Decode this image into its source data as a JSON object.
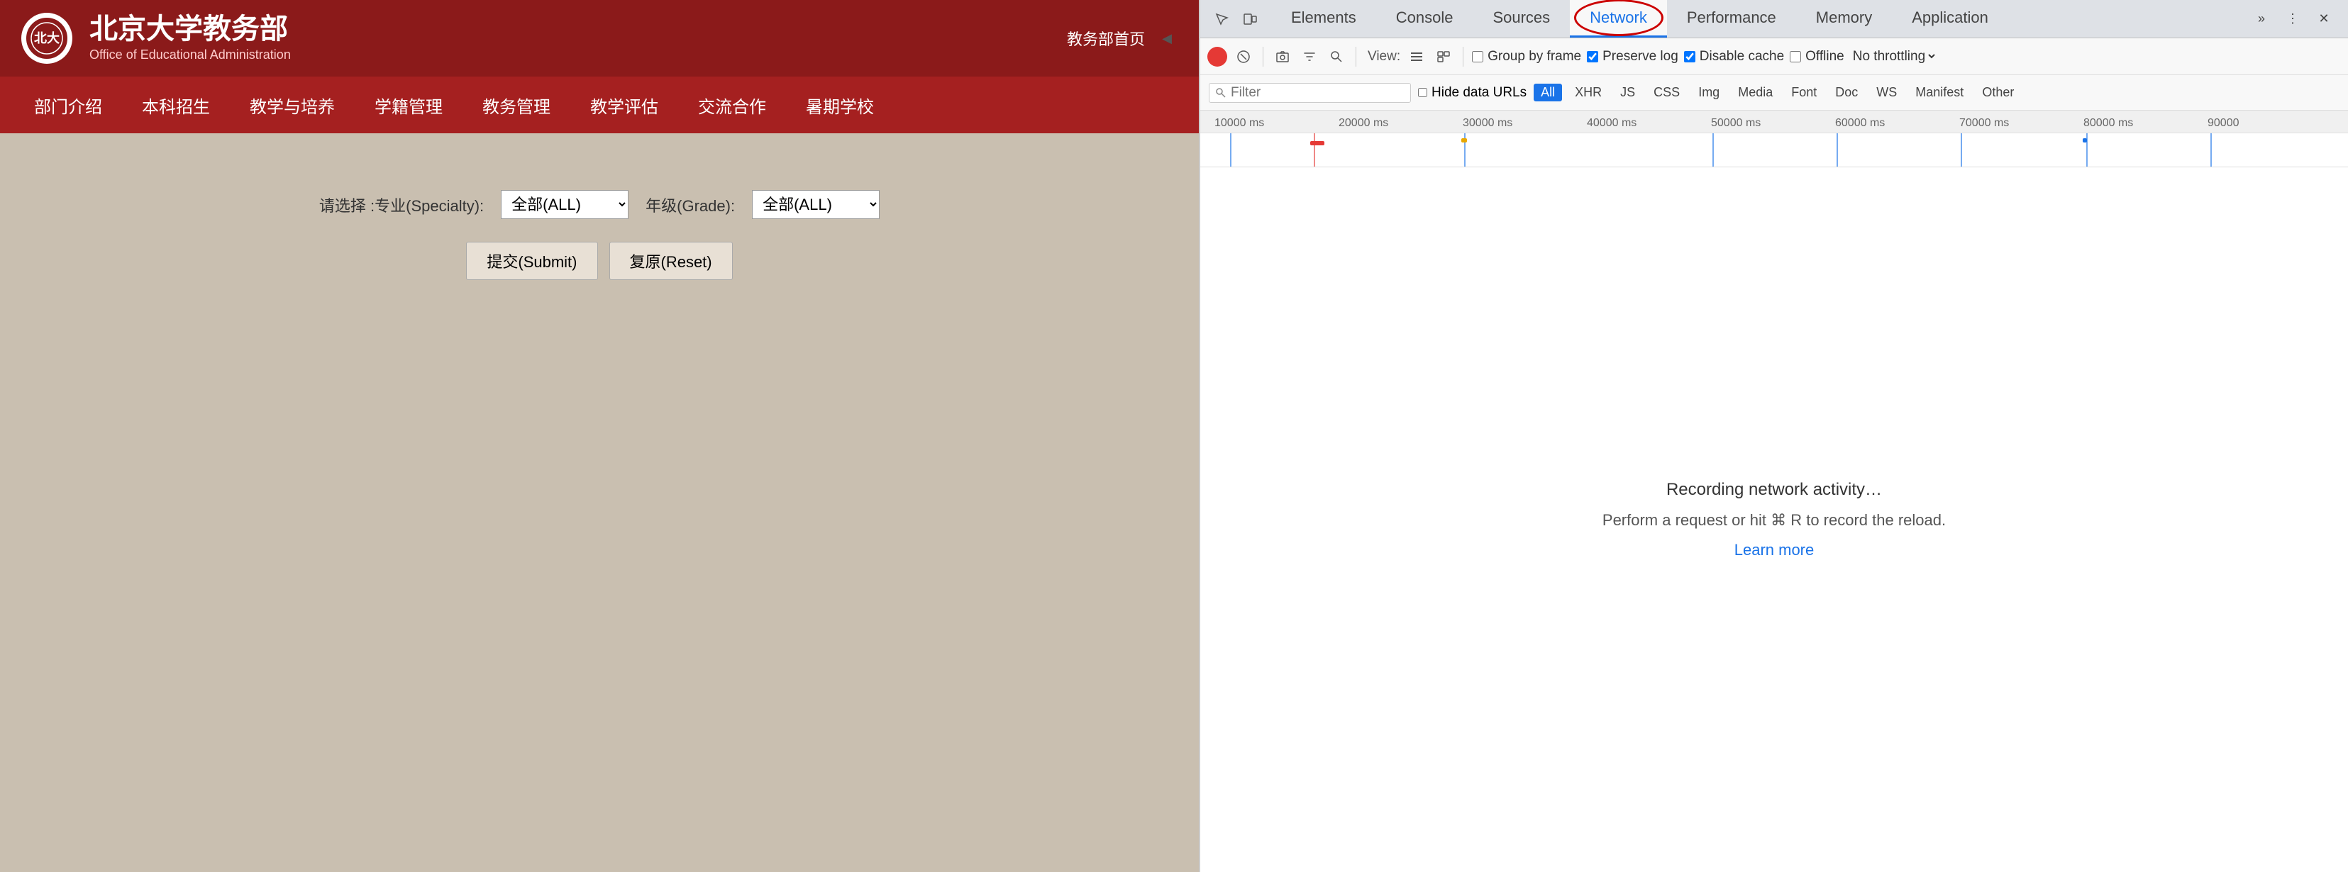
{
  "website": {
    "title_cn": "北京大学教务部",
    "title_en": "Office of Educational Administration",
    "header_link": "教务部首页",
    "nav_items": [
      "部门介绍",
      "本科招生",
      "教学与培养",
      "学籍管理",
      "教务管理",
      "教学评估",
      "交流合作",
      "暑期学校"
    ],
    "form": {
      "label1": "请选择 :专业(Specialty):",
      "select1_value": "全部(ALL)",
      "label2": "年级(Grade):",
      "select2_value": "全部(ALL)",
      "submit_label": "提交(Submit)",
      "reset_label": "复原(Reset)"
    }
  },
  "devtools": {
    "tabs": [
      "Elements",
      "Console",
      "Sources",
      "Network",
      "Performance",
      "Memory",
      "Application"
    ],
    "active_tab": "Network",
    "toolbar": {
      "view_label": "View:",
      "preserve_log_label": "Preserve log",
      "disable_cache_label": "Disable cache",
      "offline_label": "Offline",
      "no_throttling_label": "No throttling"
    },
    "filter": {
      "placeholder": "Filter",
      "hide_data_urls": "Hide data URLs",
      "types": [
        "All",
        "XHR",
        "JS",
        "CSS",
        "Img",
        "Media",
        "Font",
        "Doc",
        "WS",
        "Manifest",
        "Other"
      ]
    },
    "timeline": {
      "ticks": [
        "10000 ms",
        "20000 ms",
        "30000 ms",
        "40000 ms",
        "50000 ms",
        "60000 ms",
        "70000 ms",
        "80000 ms",
        "90000"
      ]
    },
    "recording": {
      "main_text": "Recording network activity…",
      "sub_text": "Perform a request or hit ⌘ R to record the reload.",
      "learn_more": "Learn more"
    }
  }
}
